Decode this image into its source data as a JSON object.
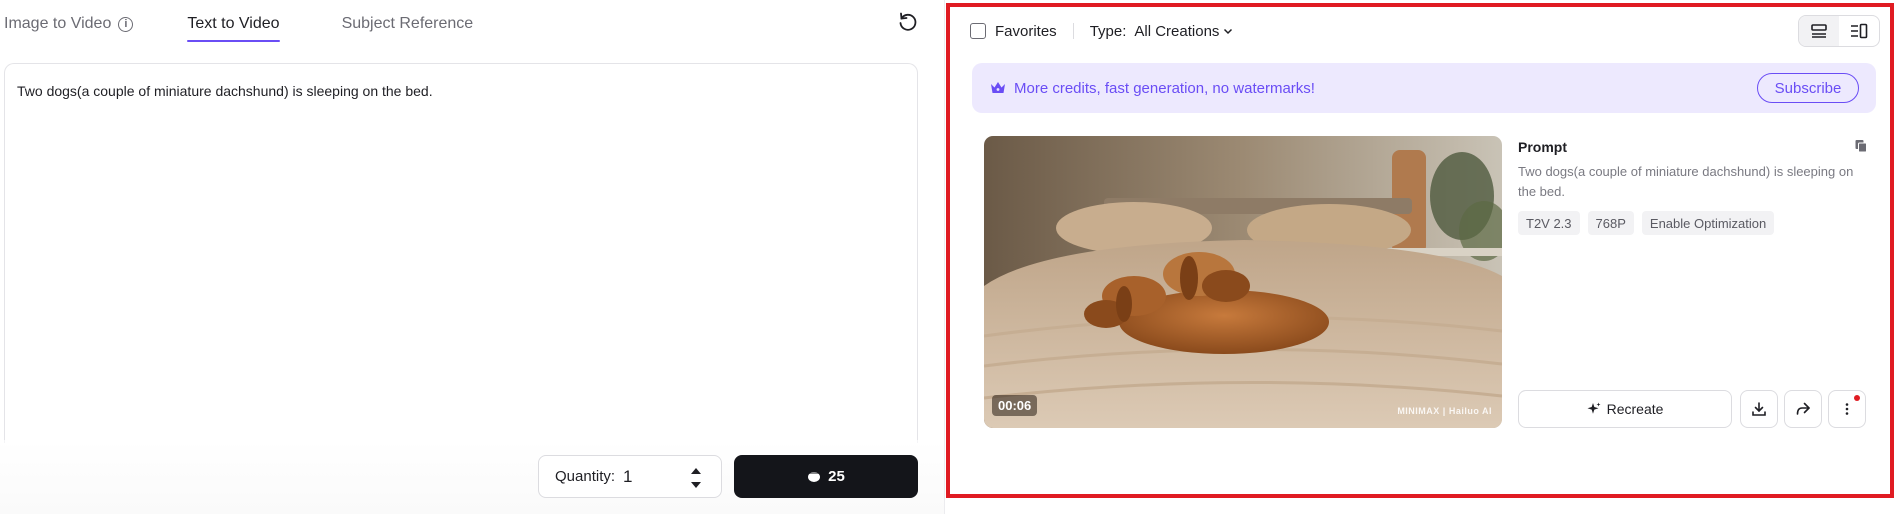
{
  "tabs": [
    {
      "label": "Image to Video",
      "active": false
    },
    {
      "label": "Text to Video",
      "active": true
    },
    {
      "label": "Subject Reference",
      "active": false
    }
  ],
  "prompt_input": {
    "value": "Two dogs(a couple of miniature dachshund) is sleeping on the bed."
  },
  "quantity": {
    "label": "Quantity:",
    "value": "1"
  },
  "generate": {
    "cost": "25"
  },
  "filters": {
    "favorites_label": "Favorites",
    "type_label": "Type:",
    "type_value": "All Creations"
  },
  "banner": {
    "text": "More credits, fast generation, no watermarks!",
    "subscribe_label": "Subscribe"
  },
  "creation": {
    "duration": "00:06",
    "watermark": "MINIMAX | Hailuo AI",
    "prompt_title": "Prompt",
    "prompt_text": "Two dogs(a couple of miniature dachshund) is sleeping on the bed.",
    "tags": [
      "T2V 2.3",
      "768P",
      "Enable Optimization"
    ],
    "recreate_label": "Recreate"
  },
  "colors": {
    "accent": "#6a4df5",
    "highlight_border": "#e01b22",
    "banner_bg": "#ede9fe",
    "primary_button": "#14151a"
  },
  "icons": [
    "info-icon",
    "reset-icon",
    "stepper-icon",
    "credit-icon",
    "chevron-down-icon",
    "list-view-icon",
    "detail-view-icon",
    "crown-icon",
    "copy-icon",
    "sparkle-icon",
    "download-icon",
    "share-icon",
    "more-icon"
  ]
}
